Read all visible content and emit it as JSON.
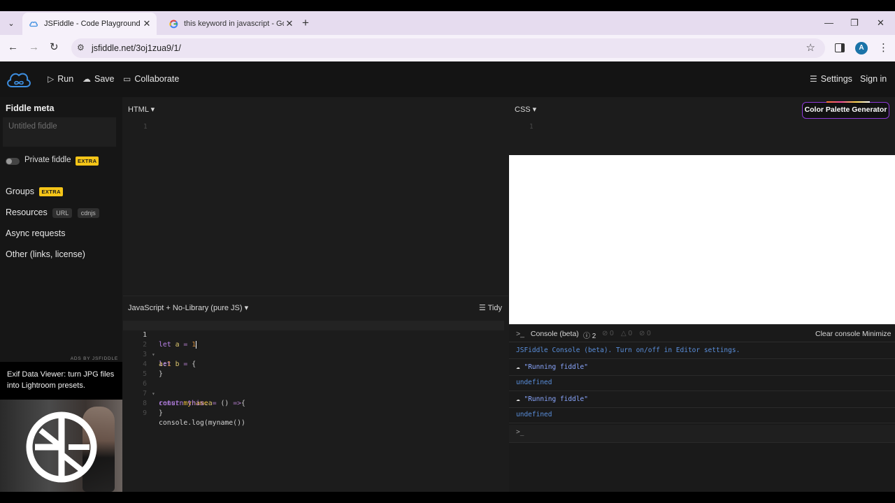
{
  "browser": {
    "tabs": [
      {
        "title": "JSFiddle - Code Playground",
        "active": true
      },
      {
        "title": "this keyword in javascript - Goo",
        "active": false
      }
    ],
    "url": "jsfiddle.net/3oj1zua9/1/",
    "profile_initial": "A"
  },
  "header": {
    "run_label": "Run",
    "save_label": "Save",
    "collaborate_label": "Collaborate",
    "settings_label": "Settings",
    "signin_label": "Sign in"
  },
  "sidebar": {
    "meta_title": "Fiddle meta",
    "name_placeholder": "Untitled fiddle",
    "private_label": "Private fiddle",
    "extra_badge": "EXTRA",
    "groups_label": "Groups",
    "resources_label": "Resources",
    "resources_pills": [
      "URL",
      "cdnjs"
    ],
    "async_label": "Async requests",
    "other_label": "Other (links, license)",
    "ads_label": "ADS BY JSFIDDLE",
    "ad_text": "Exif Data Viewer: turn JPG files into Lightroom presets."
  },
  "html_pane": {
    "label": "HTML",
    "line_number": "1"
  },
  "css_pane": {
    "label": "CSS",
    "line_number": "1",
    "color_palette_button": "Color Palette Generator"
  },
  "js_pane": {
    "label": "JavaScript + No-Library (pure JS)",
    "tidy_label": "Tidy",
    "line_numbers": [
      "1",
      "2",
      "3",
      "4",
      "5",
      "6",
      "7",
      "8",
      "9"
    ]
  },
  "console": {
    "title": "Console (beta)",
    "counts": [
      "2",
      "0",
      "0",
      "0"
    ],
    "clear_label": "Clear console",
    "minimize_label": "Minimize",
    "info_line": "JSFiddle Console (beta). Turn on/off in Editor settings.",
    "lines": [
      "\"Running fiddle\"",
      "undefined",
      "\"Running fiddle\"",
      "undefined"
    ],
    "prompt": ">_"
  },
  "colors": {
    "accent_purple": "#8e3ad8",
    "extra_badge": "#f5c518",
    "console_blue": "#5a8fdc"
  }
}
